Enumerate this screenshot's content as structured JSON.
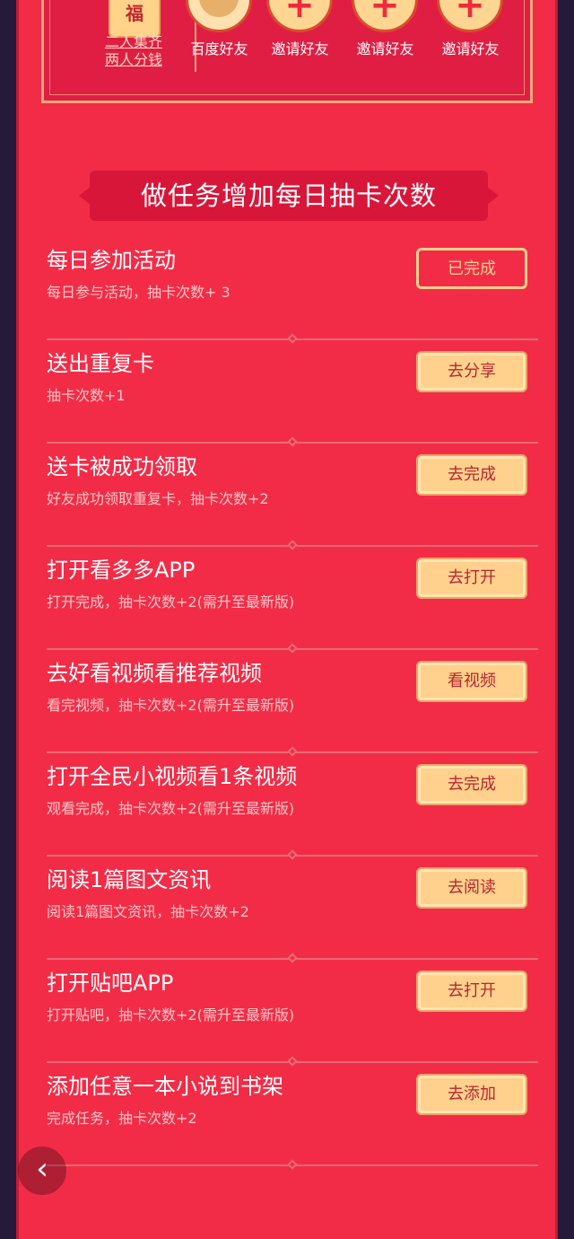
{
  "invite": {
    "collect_line1": "二人集齐",
    "collect_line2": "两人分钱",
    "friends": [
      {
        "label": "百度好友",
        "type": "avatar"
      },
      {
        "label": "邀请好友",
        "type": "plus"
      },
      {
        "label": "邀请好友",
        "type": "plus"
      },
      {
        "label": "邀请好友",
        "type": "plus"
      }
    ],
    "plus_symbol": "+"
  },
  "banner": {
    "title": "做任务增加每日抽卡次数"
  },
  "tasks": [
    {
      "title": "每日参加活动",
      "desc": "每日参与活动，抽卡次数+ 3",
      "button": "已完成",
      "done": true
    },
    {
      "title": "送出重复卡",
      "desc": "抽卡次数+1",
      "button": "去分享",
      "done": false
    },
    {
      "title": "送卡被成功领取",
      "desc": "好友成功领取重复卡，抽卡次数+2",
      "button": "去完成",
      "done": false
    },
    {
      "title": "打开看多多APP",
      "desc": "打开完成，抽卡次数+2(需升至最新版)",
      "button": "去打开",
      "done": false
    },
    {
      "title": "去好看视频看推荐视频",
      "desc": "看完视频，抽卡次数+2(需升至最新版)",
      "button": "看视频",
      "done": false
    },
    {
      "title": "打开全民小视频看1条视频",
      "desc": "观看完成，抽卡次数+2(需升至最新版)",
      "button": "去完成",
      "done": false
    },
    {
      "title": "阅读1篇图文资讯",
      "desc": "阅读1篇图文资讯，抽卡次数+2",
      "button": "去阅读",
      "done": false
    },
    {
      "title": "打开贴吧APP",
      "desc": "打开贴吧，抽卡次数+2(需升至最新版)",
      "button": "去打开",
      "done": false
    },
    {
      "title": "添加任意一本小说到书架",
      "desc": "完成任务，抽卡次数+2",
      "button": "去添加",
      "done": false
    }
  ],
  "nav": {
    "back_icon": "‹"
  }
}
